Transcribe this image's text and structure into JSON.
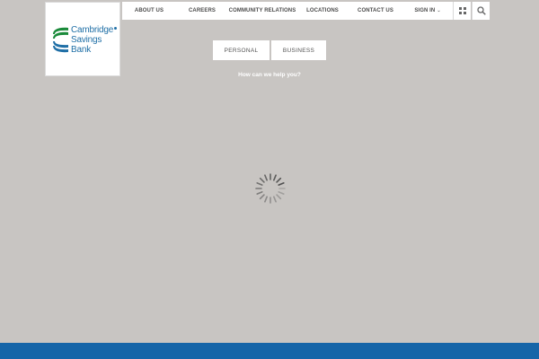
{
  "logo": {
    "lines": [
      "Cambridge",
      "Savings",
      "Bank"
    ],
    "colors": {
      "text": "#1f6fa6",
      "mark_green": "#1a8a3a",
      "mark_blue": "#1f6fa6"
    }
  },
  "nav": {
    "items": [
      {
        "label": "ABOUT US"
      },
      {
        "label": "CAREERS"
      },
      {
        "label": "COMMUNITY RELATIONS"
      },
      {
        "label": "LOCATIONS"
      },
      {
        "label": "CONTACT US"
      },
      {
        "label": "SIGN IN",
        "dropdown": true
      }
    ],
    "icons": [
      "grid-icon",
      "search-icon"
    ]
  },
  "segments": {
    "personal": "PERSONAL",
    "business": "BUSINESS"
  },
  "help_text": "How can we help you?",
  "loading": {
    "icon": "spinner-icon"
  },
  "colors": {
    "background": "#c8c5c2",
    "footer": "#1565a8",
    "nav_text": "#4b4b4b"
  }
}
